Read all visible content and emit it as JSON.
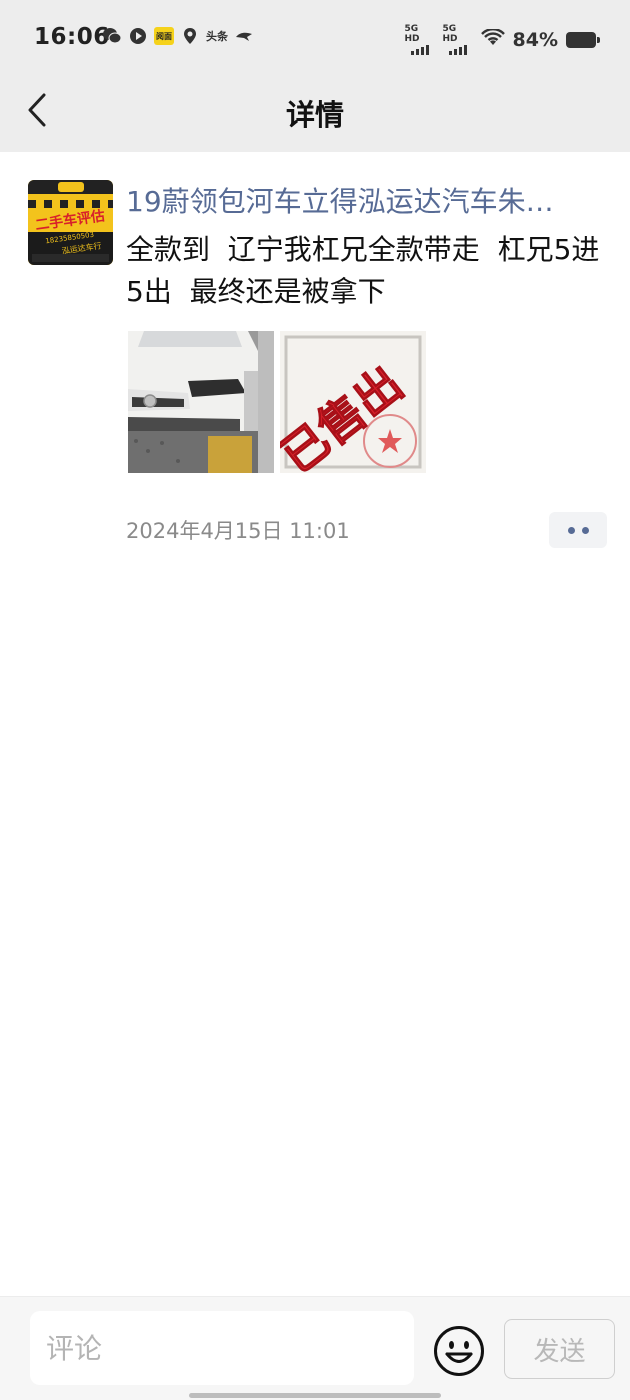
{
  "status_bar": {
    "time": "16:06",
    "left_icons": [
      "wechat-icon",
      "video-icon",
      "app-yellow-icon",
      "location-icon",
      "toutiao-icon",
      "bird-icon"
    ],
    "app_yellow_label": "阅面",
    "toutiao_label": "头条",
    "network1_label": "5G HD",
    "network2_label": "5G HD",
    "battery_percent": "84%"
  },
  "header": {
    "title": "详情",
    "back_icon": "chevron-left-icon"
  },
  "post": {
    "author": "19蔚领包河车立得泓运达汽车朱…",
    "text": "全款到  辽宁我杠兄全款带走  杠兄5进5出  最终还是被拿下",
    "avatar": {
      "line1": "二手车评估",
      "phone": "18235850503",
      "shop": "泓运达车行"
    },
    "photos": [
      {
        "description": "white-car"
      },
      {
        "stamp_text": "已售出"
      }
    ],
    "timestamp": "2024年4月15日 11:01"
  },
  "comment_bar": {
    "placeholder": "评论",
    "value": "",
    "send_label": "发送"
  },
  "colors": {
    "link_blue": "#576b95",
    "band_grey": "#ededed",
    "stamp_red": "#d8202a"
  }
}
